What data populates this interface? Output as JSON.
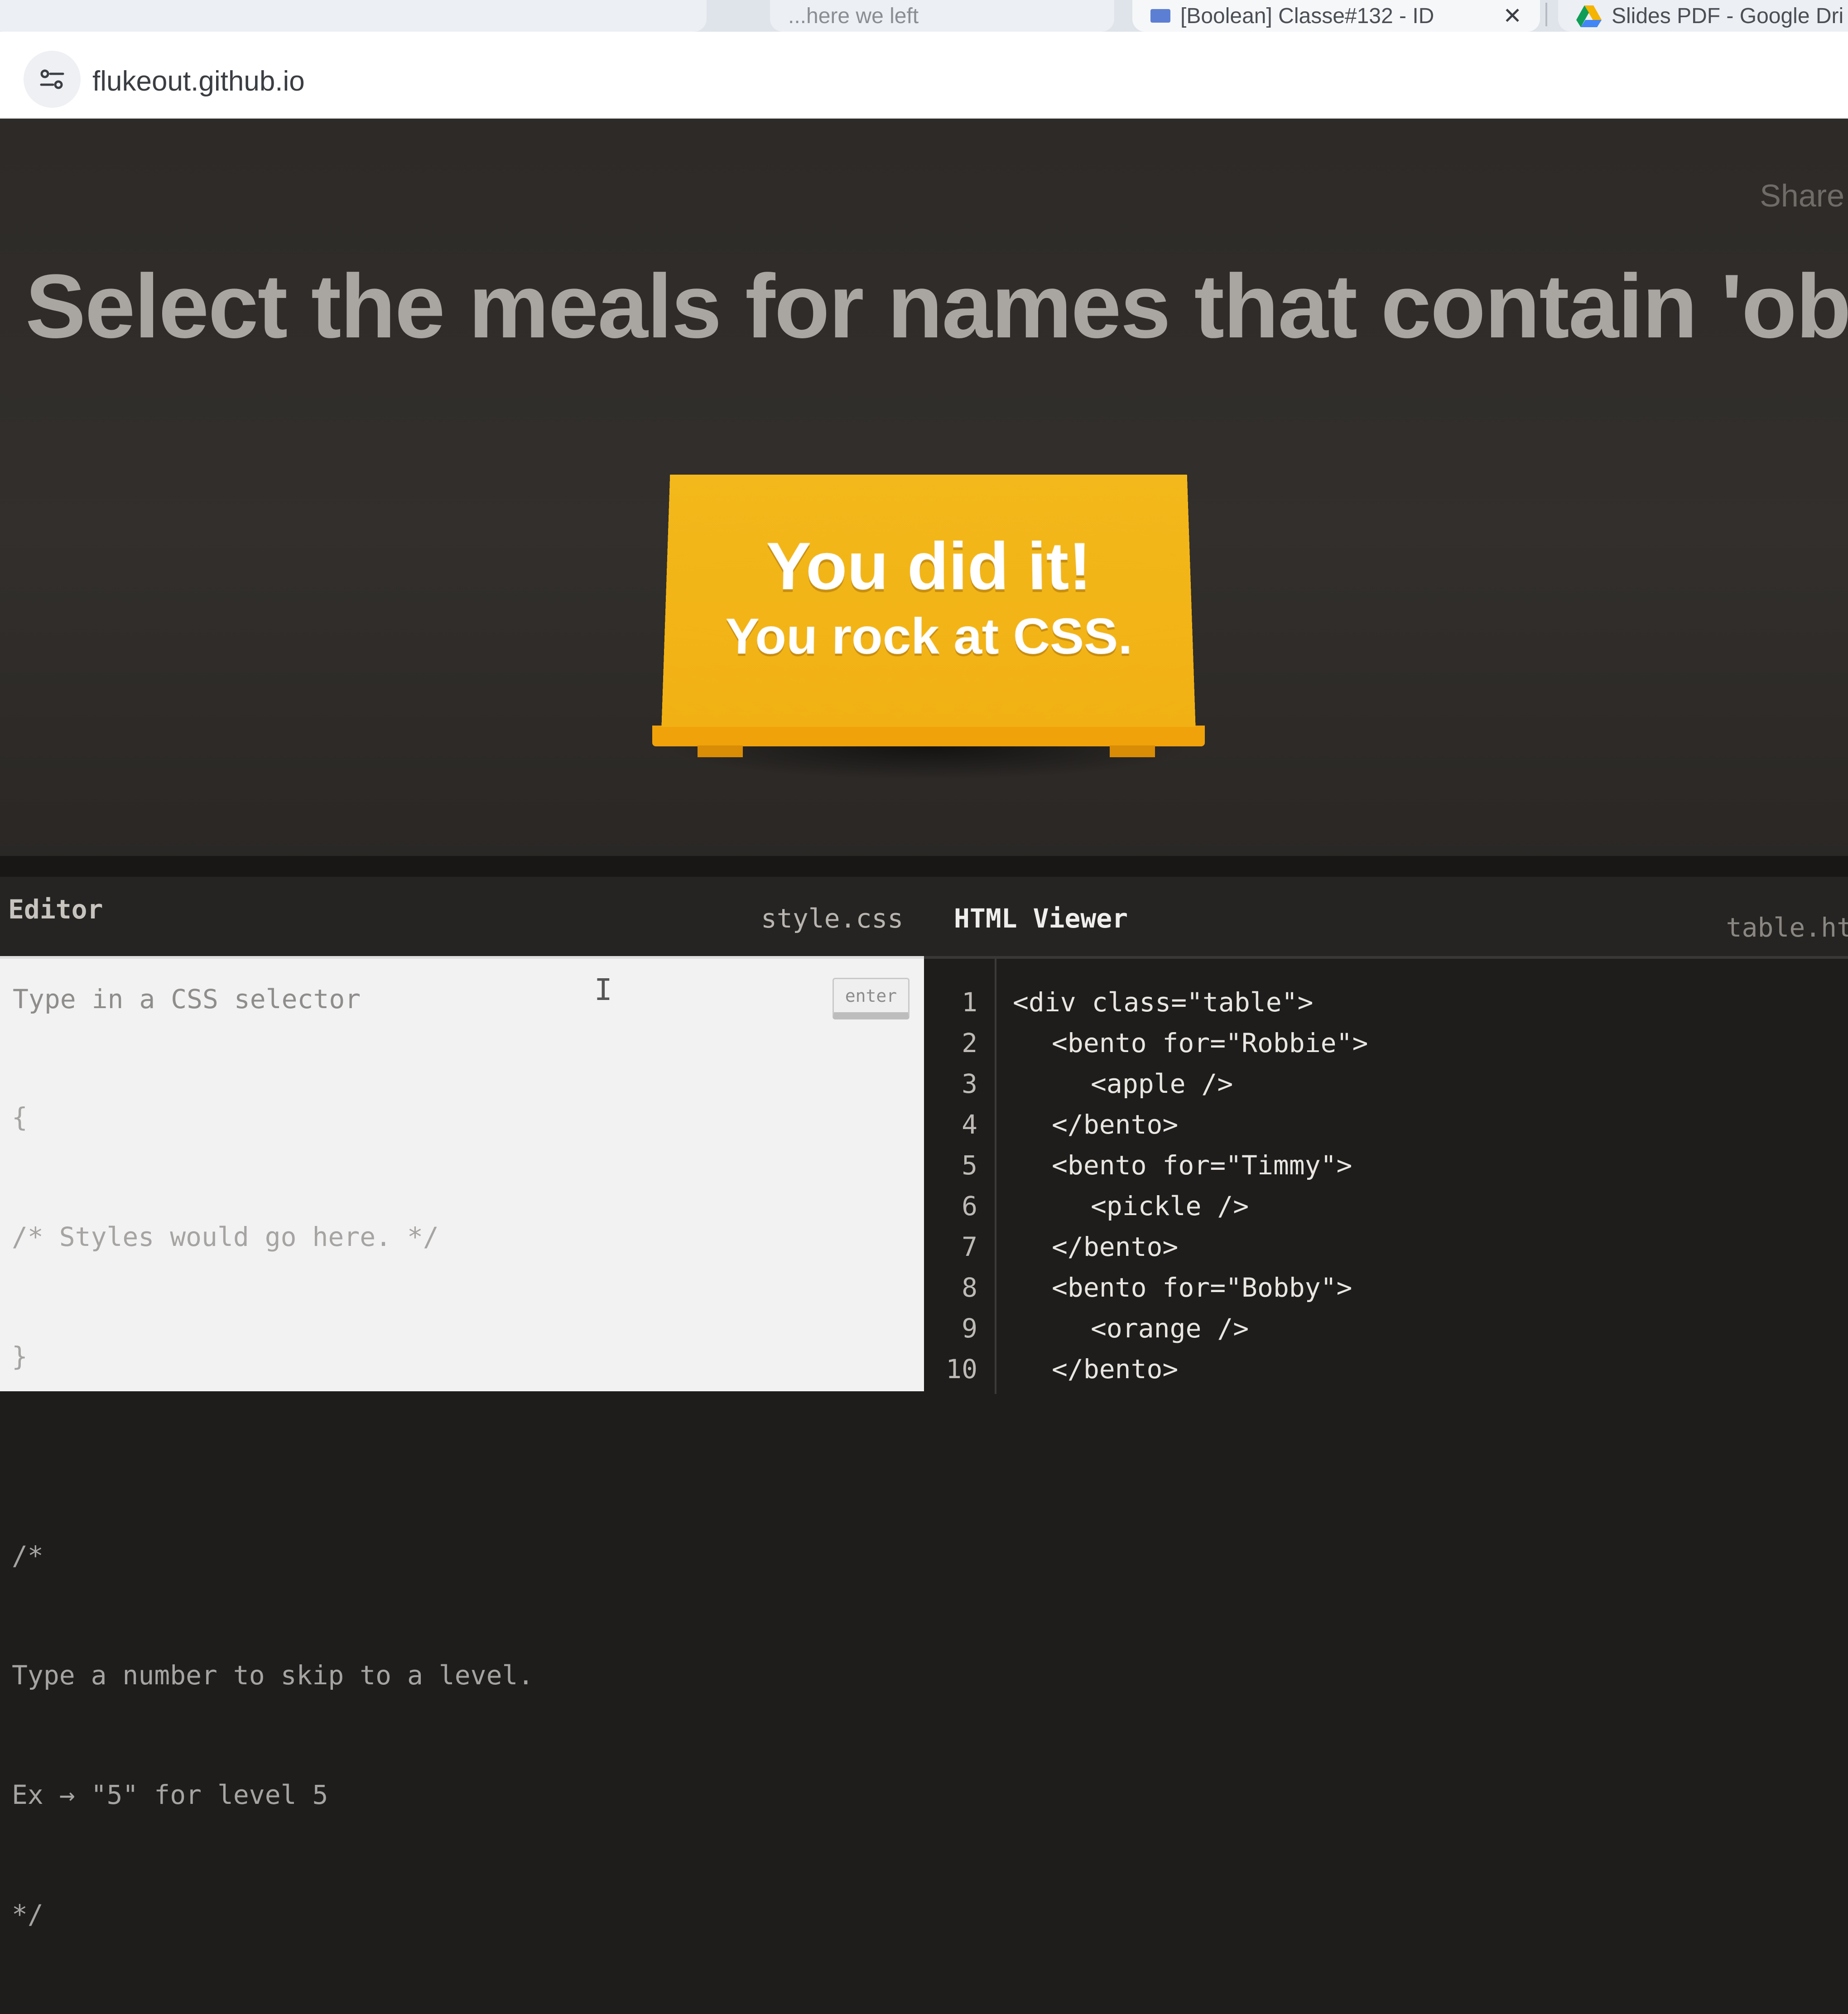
{
  "browser": {
    "tabs": [
      {
        "label": "...here we left",
        "active": false
      },
      {
        "label": "[Boolean] Classe#132 - ID",
        "active": true
      },
      {
        "label": "Slides PDF - Google Dri",
        "active": false
      }
    ],
    "close_glyph": "✕",
    "url": "flukeout.github.io"
  },
  "game": {
    "share_label": "Share",
    "instruction": "Select the meals for names that contain 'obb'",
    "win_line1": "You did it!",
    "win_line2": "You rock at CSS.",
    "table_color": "#f2b515"
  },
  "editor": {
    "title": "Editor",
    "css_file": "style.css",
    "html_title": "HTML Viewer",
    "html_file": "table.ht",
    "input_placeholder": "Type in a CSS selector",
    "enter_label": "enter",
    "css_lines": [
      "{",
      "/* Styles would go here. */",
      "}",
      "",
      "/*",
      "Type a number to skip to a level.",
      "Ex → \"5\" for level 5",
      "*/"
    ]
  },
  "html_viewer": {
    "lines": [
      {
        "num": "1",
        "indent": 0,
        "code": "<div class=\"table\">"
      },
      {
        "num": "2",
        "indent": 1,
        "code": "<bento for=\"Robbie\">"
      },
      {
        "num": "3",
        "indent": 2,
        "code": "<apple />"
      },
      {
        "num": "4",
        "indent": 1,
        "code": "</bento>"
      },
      {
        "num": "5",
        "indent": 1,
        "code": "<bento for=\"Timmy\">"
      },
      {
        "num": "6",
        "indent": 2,
        "code": "<pickle />"
      },
      {
        "num": "7",
        "indent": 1,
        "code": "</bento>"
      },
      {
        "num": "8",
        "indent": 1,
        "code": "<bento for=\"Bobby\">"
      },
      {
        "num": "9",
        "indent": 2,
        "code": "<orange />"
      },
      {
        "num": "10",
        "indent": 1,
        "code": "</bento>"
      }
    ]
  }
}
